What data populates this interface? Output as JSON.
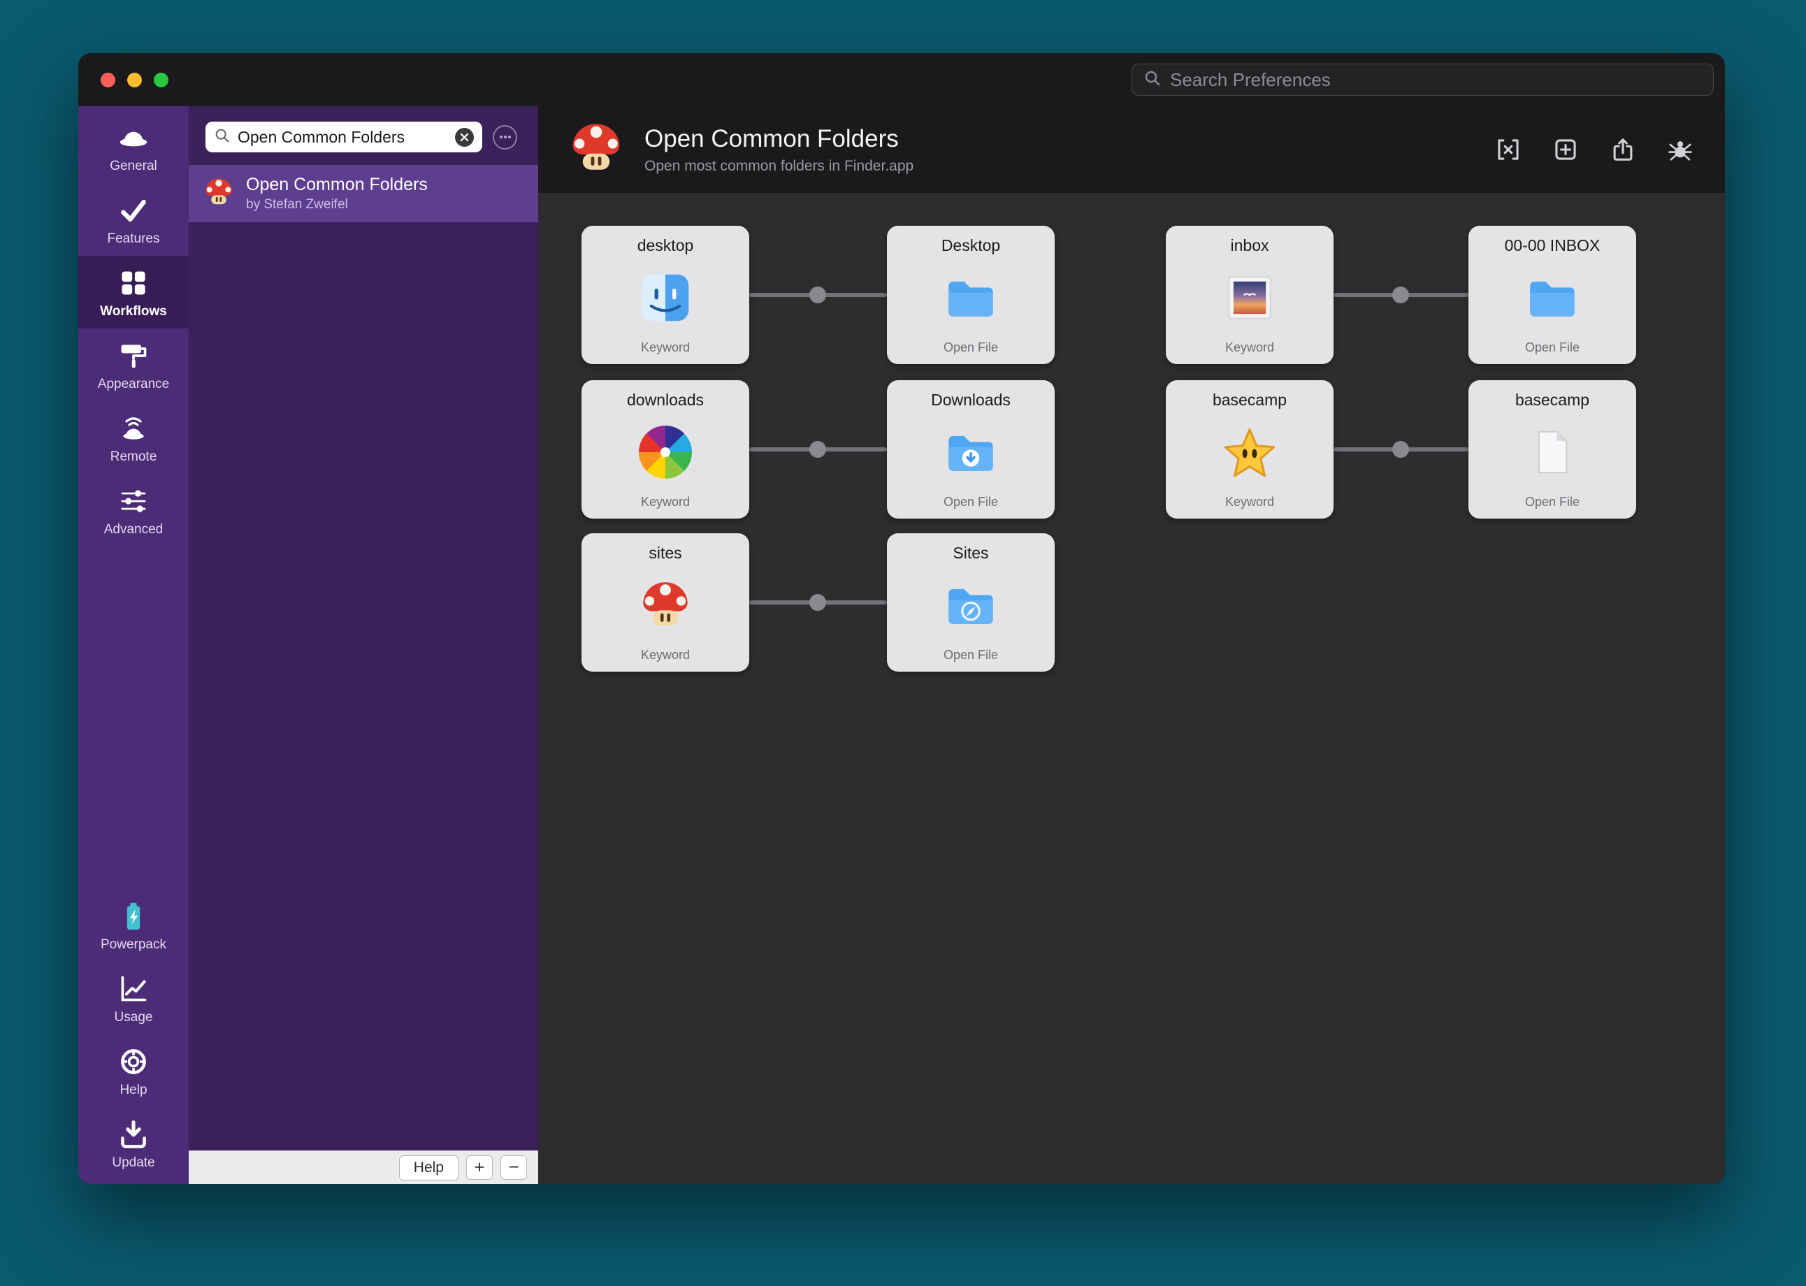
{
  "window": {
    "search_placeholder": "Search Preferences"
  },
  "sidebar": {
    "items": [
      {
        "label": "General",
        "icon": "hat-icon",
        "selected": false
      },
      {
        "label": "Features",
        "icon": "check-icon",
        "selected": false
      },
      {
        "label": "Workflows",
        "icon": "grid-icon",
        "selected": true
      },
      {
        "label": "Appearance",
        "icon": "paint-roller-icon",
        "selected": false
      },
      {
        "label": "Remote",
        "icon": "remote-hat-icon",
        "selected": false
      },
      {
        "label": "Advanced",
        "icon": "sliders-icon",
        "selected": false
      },
      {
        "label": "Powerpack",
        "icon": "battery-icon",
        "selected": false
      },
      {
        "label": "Usage",
        "icon": "chart-icon",
        "selected": false
      },
      {
        "label": "Help",
        "icon": "lifebuoy-icon",
        "selected": false
      },
      {
        "label": "Update",
        "icon": "download-tray-icon",
        "selected": false
      }
    ]
  },
  "workflow_list": {
    "search_value": "Open Common Folders",
    "selected_item": {
      "title": "Open Common Folders",
      "author": "by Stefan Zweifel",
      "icon": "mushroom-icon"
    },
    "footer": {
      "help_label": "Help",
      "add_label": "+",
      "remove_label": "−"
    }
  },
  "header": {
    "title": "Open Common Folders",
    "subtitle": "Open most common folders in Finder.app",
    "icon": "mushroom-icon",
    "actions": [
      "variables-icon",
      "add-object-icon",
      "share-icon",
      "debug-icon"
    ]
  },
  "canvas": {
    "nodes": [
      {
        "title": "desktop",
        "type_label": "Keyword",
        "icon": "finder-icon"
      },
      {
        "title": "Desktop",
        "type_label": "Open File",
        "icon": "folder-icon"
      },
      {
        "title": "inbox",
        "type_label": "Keyword",
        "icon": "mail-stamp-icon"
      },
      {
        "title": "00-00 INBOX",
        "type_label": "Open File",
        "icon": "folder-icon"
      },
      {
        "title": "downloads",
        "type_label": "Keyword",
        "icon": "pinwheel-icon"
      },
      {
        "title": "Downloads",
        "type_label": "Open File",
        "icon": "folder-download-icon"
      },
      {
        "title": "basecamp",
        "type_label": "Keyword",
        "icon": "star-icon"
      },
      {
        "title": "basecamp",
        "type_label": "Open File",
        "icon": "document-icon"
      },
      {
        "title": "sites",
        "type_label": "Keyword",
        "icon": "mushroom-icon"
      },
      {
        "title": "Sites",
        "type_label": "Open File",
        "icon": "folder-compass-icon"
      }
    ],
    "connections": [
      {
        "from": "desktop",
        "to": "Desktop"
      },
      {
        "from": "inbox",
        "to": "00-00 INBOX"
      },
      {
        "from": "downloads",
        "to": "Downloads"
      },
      {
        "from": "basecamp",
        "to": "basecamp"
      },
      {
        "from": "sites",
        "to": "Sites"
      }
    ]
  },
  "colors": {
    "desktop_background": "#0A5A6E",
    "titlebar": "#1B1B1D",
    "sidebar_purple": "#4D2C77",
    "sidebar_selected": "#371D55",
    "list_background": "#3B2159",
    "list_selection": "#5E3F8F",
    "canvas_background": "#2D2D2F",
    "node_card": "#E4E4E6",
    "folder_blue": "#4FA6F3",
    "traffic_red": "#FF5F57",
    "traffic_yellow": "#FEBC2E",
    "traffic_green": "#28C840"
  }
}
